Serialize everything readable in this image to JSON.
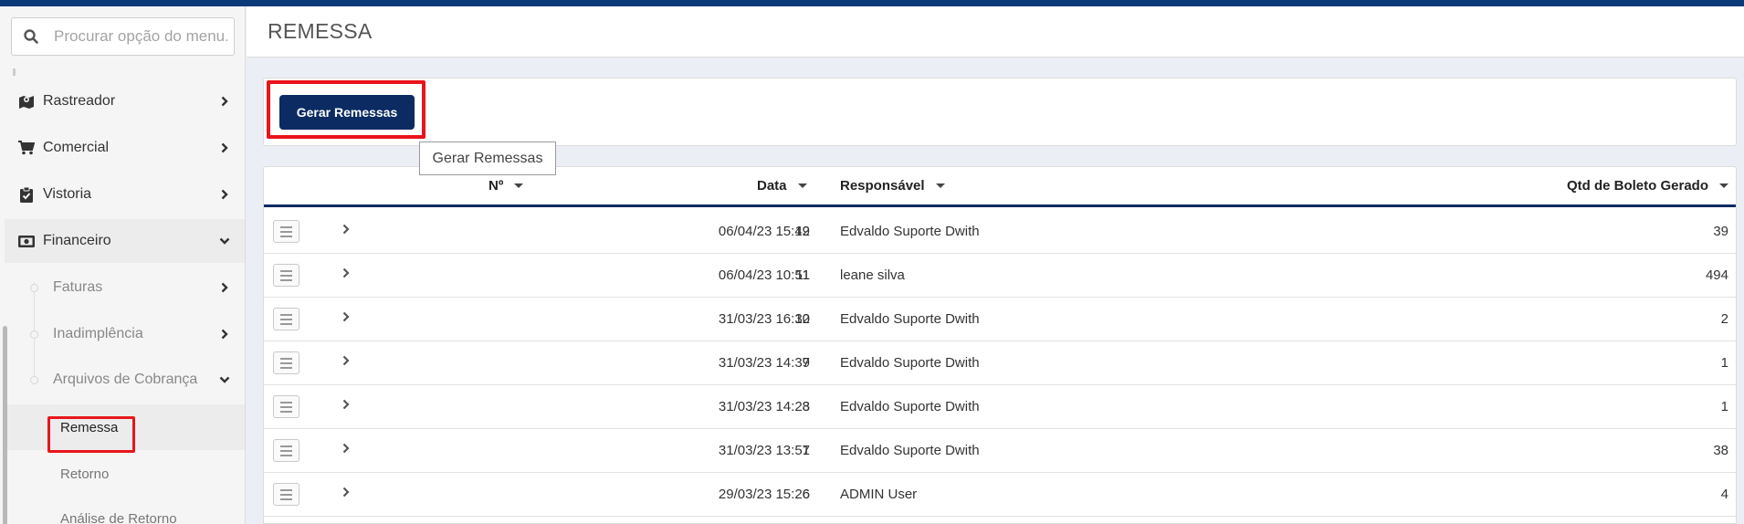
{
  "sidebar": {
    "search_placeholder": "Procurar opção do menu...",
    "menu": [
      {
        "label": "Rastreador",
        "icon": "map-marker-icon"
      },
      {
        "label": "Comercial",
        "icon": "shopping-cart-icon"
      },
      {
        "label": "Vistoria",
        "icon": "clipboard-check-icon"
      },
      {
        "label": "Financeiro",
        "icon": "money-bill-icon",
        "expanded": true
      }
    ],
    "financeiro_sub": [
      {
        "label": "Faturas"
      },
      {
        "label": "Inadimplência"
      },
      {
        "label": "Arquivos de Cobrança",
        "expanded": true
      }
    ],
    "arquivos_sub": [
      {
        "label": "Remessa",
        "selected": true
      },
      {
        "label": "Retorno"
      },
      {
        "label": "Análise de Retorno"
      }
    ]
  },
  "page": {
    "title": "REMESSA",
    "generate_button": "Gerar Remessas",
    "tooltip": "Gerar Remessas"
  },
  "table": {
    "headers": {
      "num": "Nº",
      "date": "Data",
      "resp": "Responsável",
      "qtd": "Qtd de Boleto Gerado"
    },
    "rows": [
      {
        "num": "12",
        "date": "06/04/23 15:49",
        "resp": "Edvaldo Suporte Dwith",
        "qtd": "39"
      },
      {
        "num": "11",
        "date": "06/04/23 10:51",
        "resp": "leane silva",
        "qtd": "494"
      },
      {
        "num": "10",
        "date": "31/03/23 16:32",
        "resp": "Edvaldo Suporte Dwith",
        "qtd": "2"
      },
      {
        "num": "9",
        "date": "31/03/23 14:37",
        "resp": "Edvaldo Suporte Dwith",
        "qtd": "1"
      },
      {
        "num": "8",
        "date": "31/03/23 14:23",
        "resp": "Edvaldo Suporte Dwith",
        "qtd": "1"
      },
      {
        "num": "7",
        "date": "31/03/23 13:51",
        "resp": "Edvaldo Suporte Dwith",
        "qtd": "38"
      },
      {
        "num": "6",
        "date": "29/03/23 15:26",
        "resp": "ADMIN User",
        "qtd": "4"
      }
    ]
  },
  "colors": {
    "primary": "#0b2b62",
    "highlight": "#e8151b",
    "topbar": "#0a3a78"
  }
}
